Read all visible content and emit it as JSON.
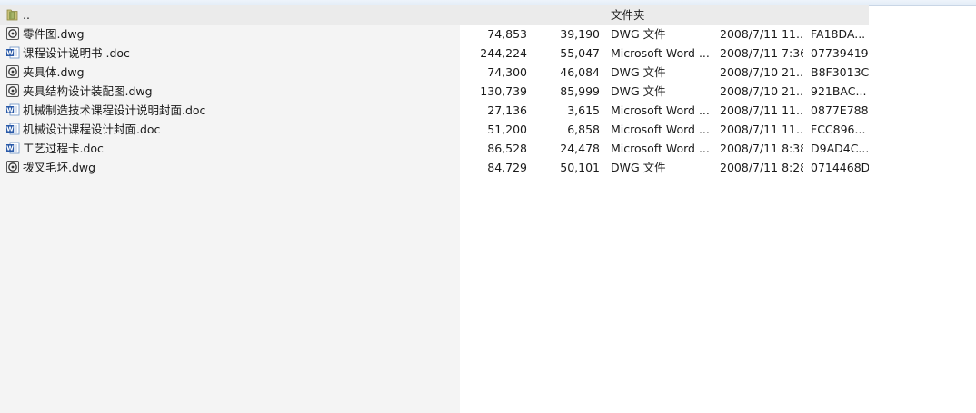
{
  "parent_row": {
    "name": "..",
    "type": "文件夹",
    "icon": "folder-icon"
  },
  "files": [
    {
      "name": "零件图.dwg",
      "size": "74,853",
      "packed": "39,190",
      "type": "DWG 文件",
      "modified": "2008/7/11 11...",
      "crc": "FA18DA...",
      "icon": "dwg-icon"
    },
    {
      "name": "课程设计说明书 .doc",
      "size": "244,224",
      "packed": "55,047",
      "type": "Microsoft Word ...",
      "modified": "2008/7/11 7:36",
      "crc": "07739419",
      "icon": "word-doc-icon"
    },
    {
      "name": "夹具体.dwg",
      "size": "74,300",
      "packed": "46,084",
      "type": "DWG 文件",
      "modified": "2008/7/10 21...",
      "crc": "B8F3013C",
      "icon": "dwg-icon"
    },
    {
      "name": "夹具结构设计装配图.dwg",
      "size": "130,739",
      "packed": "85,999",
      "type": "DWG 文件",
      "modified": "2008/7/10 21...",
      "crc": "921BAC...",
      "icon": "dwg-icon"
    },
    {
      "name": "机械制造技术课程设计说明封面.doc",
      "size": "27,136",
      "packed": "3,615",
      "type": "Microsoft Word ...",
      "modified": "2008/7/11 11...",
      "crc": "0877E788",
      "icon": "word-doc-icon"
    },
    {
      "name": "机械设计课程设计封面.doc",
      "size": "51,200",
      "packed": "6,858",
      "type": "Microsoft Word ...",
      "modified": "2008/7/11 11...",
      "crc": "FCC896...",
      "icon": "word-doc-icon"
    },
    {
      "name": "工艺过程卡.doc",
      "size": "86,528",
      "packed": "24,478",
      "type": "Microsoft Word ...",
      "modified": "2008/7/11 8:38",
      "crc": "D9AD4C...",
      "icon": "word-doc-icon"
    },
    {
      "name": "拨叉毛坯.dwg",
      "size": "84,729",
      "packed": "50,101",
      "type": "DWG 文件",
      "modified": "2008/7/11 8:28",
      "crc": "0714468D",
      "icon": "dwg-icon"
    }
  ]
}
